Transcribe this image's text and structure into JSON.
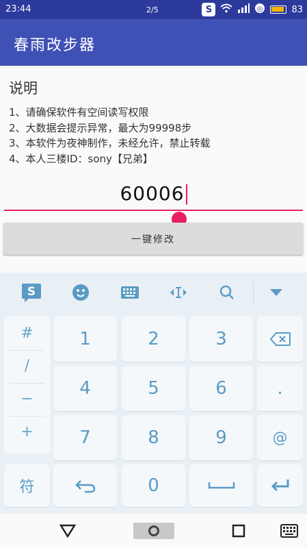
{
  "status": {
    "time": "23:44",
    "page_indicator": "2/5",
    "battery": "83"
  },
  "app": {
    "title": "春雨改步器"
  },
  "content": {
    "heading": "说明",
    "notes": [
      "1、请确保软件有空间读写权限",
      "2、大数据会提示异常，最大为99998步",
      "3、本软件为夜神制作，未经允许，禁止转载",
      "4、本人三楼ID：sony【兄弟】"
    ],
    "step_value": "60006",
    "modify_button": "一键修改"
  },
  "keyboard": {
    "symbols": [
      "#",
      "/",
      "−",
      "+"
    ],
    "digits": [
      "1",
      "2",
      "3",
      "4",
      "5",
      "6",
      "7",
      "8",
      "9",
      "0"
    ],
    "dot_key": ".",
    "at_key": "@",
    "fu_key": "符",
    "logo": "S"
  },
  "colors": {
    "status_bar": "#2c3a9c",
    "app_bar": "#3f51b5",
    "accent": "#e91e63",
    "keyboard_bg": "#e9f0f5",
    "key_text": "#5a9bc4"
  }
}
